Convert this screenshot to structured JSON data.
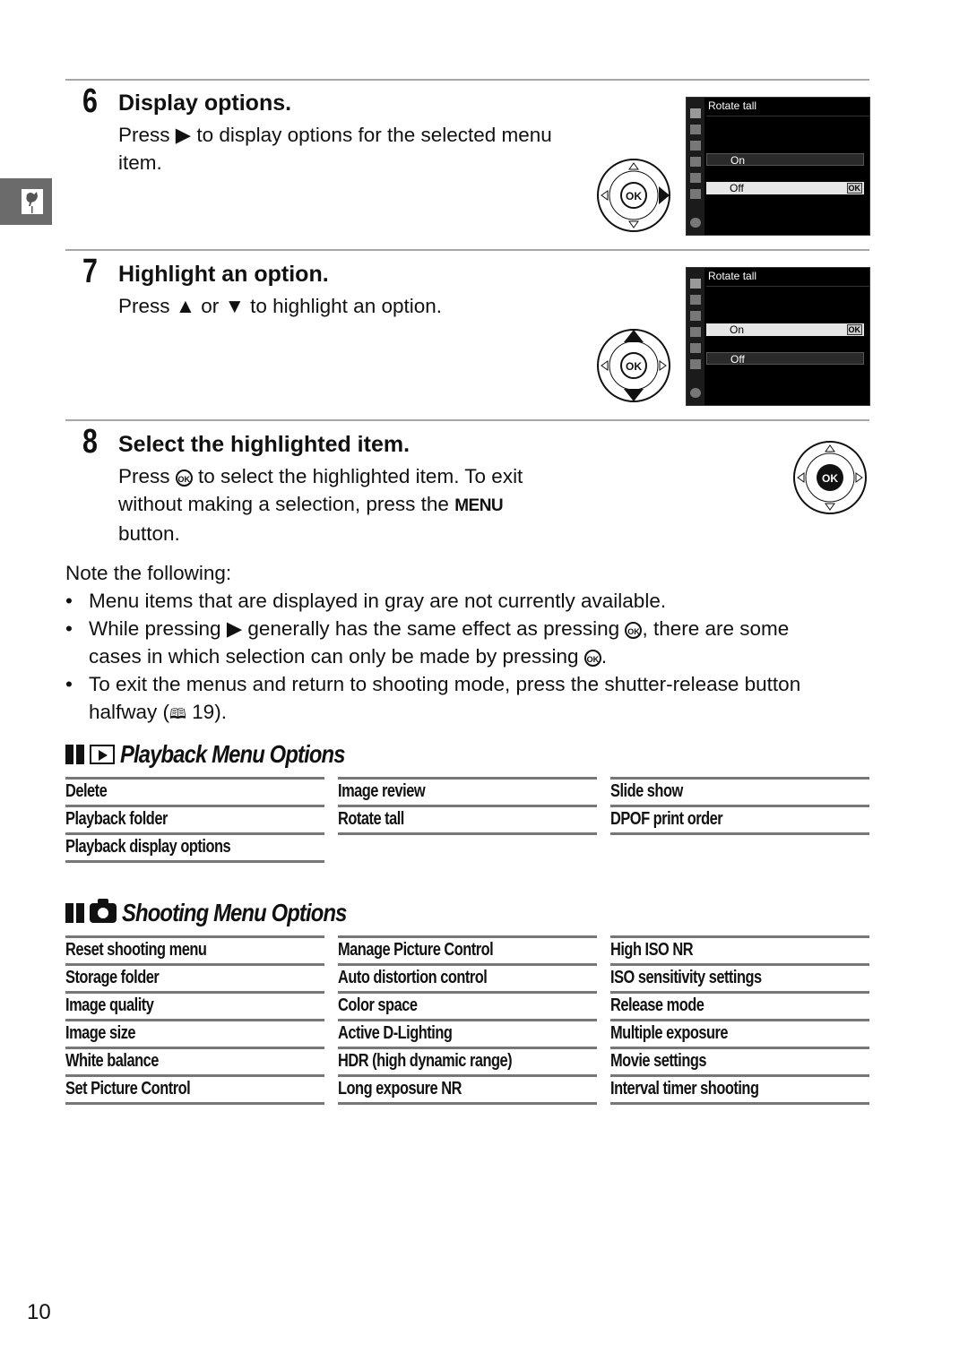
{
  "steps": [
    {
      "number": "6",
      "title": "Display options.",
      "body_parts": [
        "Press ",
        " to display options for the selected menu",
        "item."
      ],
      "screen": {
        "title": "Rotate tall",
        "options": [
          {
            "label": "On",
            "state": "unselected"
          },
          {
            "label": "Off",
            "state": "highlighted",
            "ok_badge": "OK"
          }
        ]
      },
      "dial_pressed": "right"
    },
    {
      "number": "7",
      "title": "Highlight an option.",
      "body_parts": [
        "Press ",
        " or ",
        " to highlight an option."
      ],
      "screen": {
        "title": "Rotate tall",
        "options": [
          {
            "label": "On",
            "state": "highlighted",
            "ok_badge": "OK"
          },
          {
            "label": "Off",
            "state": "unselected"
          }
        ]
      },
      "dial_pressed": "up-down"
    },
    {
      "number": "8",
      "title": "Select the highlighted item.",
      "body_lines": [
        [
          "Press ",
          "OK",
          " to select the highlighted item.  To exit"
        ],
        [
          "without making a selection, press the ",
          "MENU"
        ],
        [
          "button."
        ]
      ],
      "dial_pressed": "center"
    }
  ],
  "dial": {
    "center_label": "OK"
  },
  "notes": {
    "intro": "Note the following:",
    "bullets": [
      {
        "lines": [
          [
            "Menu items that are displayed in gray are not currently available."
          ]
        ]
      },
      {
        "lines": [
          [
            "While pressing ",
            "▶",
            " generally has the same effect as pressing ",
            "OK",
            ", there are some"
          ],
          [
            "cases in which selection can only be made by pressing ",
            "OK",
            "."
          ]
        ]
      },
      {
        "lines": [
          [
            "To exit the menus and return to shooting mode, press the shutter-release button"
          ],
          [
            "halfway (",
            "📖",
            " 19)."
          ]
        ]
      }
    ]
  },
  "playback_section": {
    "title": "Playback Menu Options",
    "icon": "playback-icon",
    "columns": [
      [
        "Delete",
        "Playback folder",
        "Playback display options"
      ],
      [
        "Image review",
        "Rotate tall"
      ],
      [
        "Slide show",
        "DPOF print order"
      ]
    ]
  },
  "shooting_section": {
    "title": "Shooting Menu Options",
    "icon": "camera-icon",
    "columns": [
      [
        "Reset shooting menu",
        "Storage folder",
        "Image quality",
        "Image size",
        "White balance",
        "Set Picture Control"
      ],
      [
        "Manage Picture Control",
        "Auto distortion control",
        "Color space",
        "Active D-Lighting",
        "HDR (high dynamic range)",
        "Long exposure NR"
      ],
      [
        "High ISO NR",
        "ISO sensitivity settings",
        "Release mode",
        "Multiple exposure",
        "Movie settings",
        "Interval timer shooting"
      ]
    ]
  },
  "page_number": "10"
}
